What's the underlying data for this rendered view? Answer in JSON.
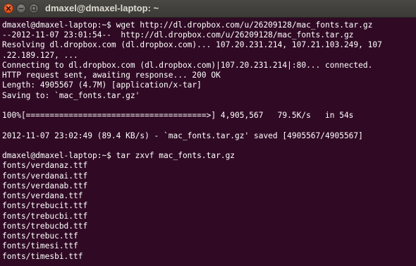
{
  "window": {
    "title": "dmaxel@dmaxel-laptop: ~"
  },
  "terminal": {
    "lines": [
      "dmaxel@dmaxel-laptop:~$ wget http://dl.dropbox.com/u/26209128/mac_fonts.tar.gz",
      "--2012-11-07 23:01:54--  http://dl.dropbox.com/u/26209128/mac_fonts.tar.gz",
      "Resolving dl.dropbox.com (dl.dropbox.com)... 107.20.231.214, 107.21.103.249, 107",
      ".22.189.127, ...",
      "Connecting to dl.dropbox.com (dl.dropbox.com)|107.20.231.214|:80... connected.",
      "HTTP request sent, awaiting response... 200 OK",
      "Length: 4905567 (4.7M) [application/x-tar]",
      "Saving to: `mac_fonts.tar.gz'",
      "",
      "100%[======================================>] 4,905,567   79.5K/s   in 54s",
      "",
      "2012-11-07 23:02:49 (89.4 KB/s) - `mac_fonts.tar.gz' saved [4905567/4905567]",
      "",
      "dmaxel@dmaxel-laptop:~$ tar zxvf mac_fonts.tar.gz",
      "fonts/verdanaz.ttf",
      "fonts/verdanai.ttf",
      "fonts/verdanab.ttf",
      "fonts/verdana.ttf",
      "fonts/trebucit.ttf",
      "fonts/trebucbi.ttf",
      "fonts/trebucbd.ttf",
      "fonts/trebuc.ttf",
      "fonts/timesi.ttf",
      "fonts/timesbi.ttf"
    ]
  },
  "colors": {
    "terminal_background": "#300a24",
    "terminal_text": "#ffffff",
    "titlebar": "#3c3b37",
    "close_button": "#df4a16"
  },
  "icons": {
    "close": "close-icon",
    "minimize": "minimize-icon",
    "maximize": "maximize-icon"
  }
}
